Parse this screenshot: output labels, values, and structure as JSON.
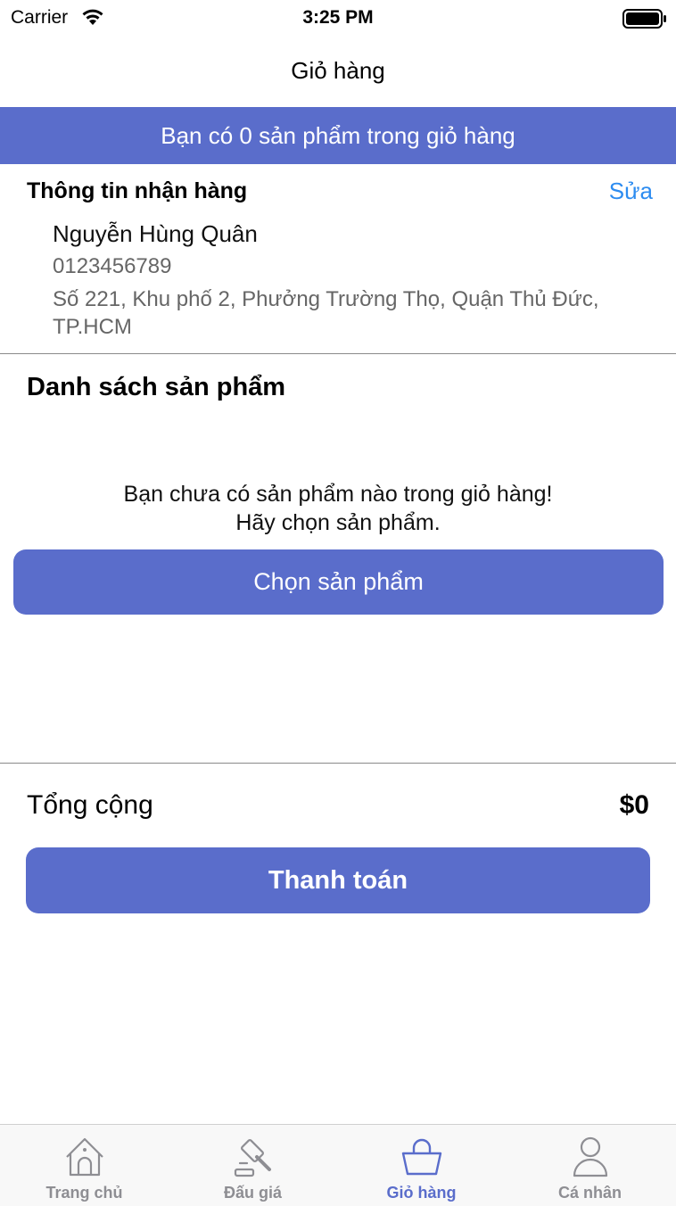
{
  "status_bar": {
    "carrier": "Carrier",
    "time": "3:25 PM"
  },
  "nav": {
    "title": "Giỏ hàng"
  },
  "banner": {
    "text": "Bạn có 0 sản phẩm trong giỏ hàng"
  },
  "shipping": {
    "title": "Thông tin nhận hàng",
    "edit_label": "Sửa",
    "name": "Nguyễn Hùng Quân",
    "phone": "0123456789",
    "address": "Số 221, Khu phố 2, Phưởng Trường Thọ, Quận Thủ Đức, TP.HCM"
  },
  "products": {
    "title": "Danh sách sản phẩm",
    "empty_line1": "Bạn chưa có sản phẩm nào trong giỏ hàng!",
    "empty_line2": "Hãy chọn sản phẩm.",
    "choose_button": "Chọn sản phẩm"
  },
  "summary": {
    "total_label": "Tổng cộng",
    "total_value": "$0",
    "checkout_button": "Thanh toán"
  },
  "tab_bar": {
    "items": [
      {
        "label": "Trang chủ",
        "icon": "home-icon",
        "active": false
      },
      {
        "label": "Đấu giá",
        "icon": "gavel-icon",
        "active": false
      },
      {
        "label": "Giỏ hàng",
        "icon": "basket-icon",
        "active": true
      },
      {
        "label": "Cá nhân",
        "icon": "person-icon",
        "active": false
      }
    ]
  },
  "colors": {
    "accent": "#5a6dcb",
    "link": "#2d8cf0",
    "inactive_tab": "#8e8e93"
  }
}
